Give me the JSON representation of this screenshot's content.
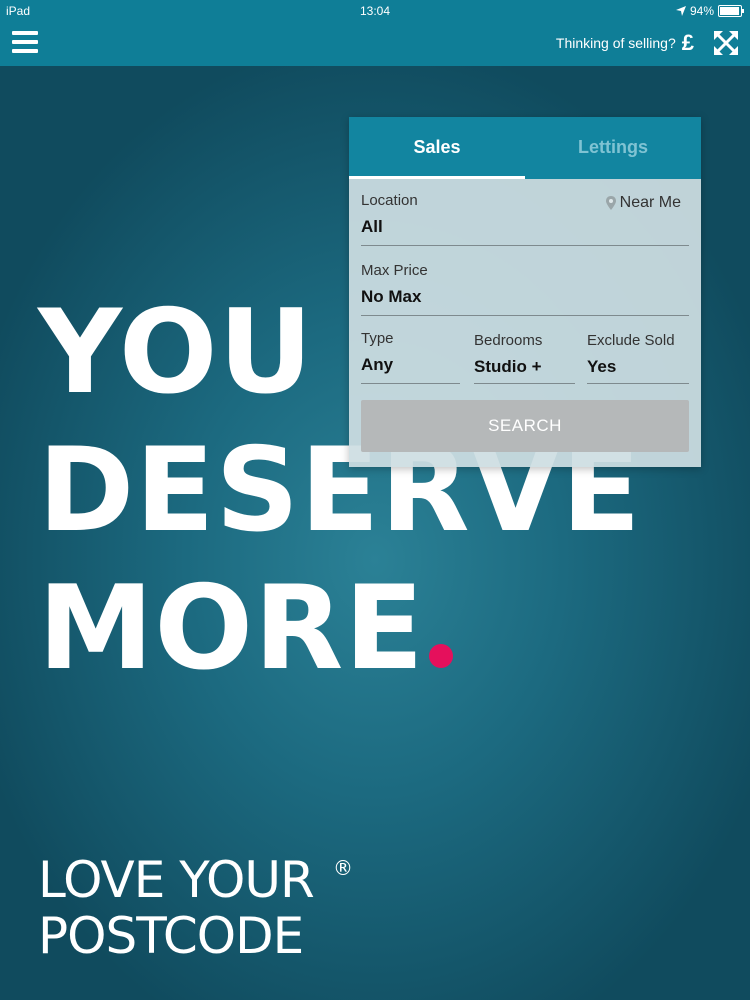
{
  "status_bar": {
    "device": "iPad",
    "time": "13:04",
    "battery_percent": "94%",
    "battery_level": 0.94
  },
  "header": {
    "menu_icon": "hamburger-menu-icon",
    "selling_text": "Thinking of selling?",
    "pound_symbol": "£",
    "expand_icon": "fullscreen-expand-icon",
    "bar_color": "#0f7e97"
  },
  "search_panel": {
    "tabs": [
      {
        "label": "Sales",
        "active": true
      },
      {
        "label": "Lettings",
        "active": false
      }
    ],
    "location": {
      "label": "Location",
      "value": "All"
    },
    "near_me": {
      "label": "Near Me",
      "icon": "location-pin-icon"
    },
    "max_price": {
      "label": "Max Price",
      "value": "No Max"
    },
    "type": {
      "label": "Type",
      "value": "Any"
    },
    "bedrooms": {
      "label": "Bedrooms",
      "value": "Studio +"
    },
    "exclude_sold": {
      "label": "Exclude Sold",
      "value": "Yes"
    },
    "search_button": "SEARCH"
  },
  "hero": {
    "line1": "YOU",
    "line2": "DESERVE",
    "line3": "MORE",
    "dot_color": "#e5105c"
  },
  "logo": {
    "line1": "LOVE YOUR",
    "line2": "POSTCODE",
    "registered": "®"
  }
}
